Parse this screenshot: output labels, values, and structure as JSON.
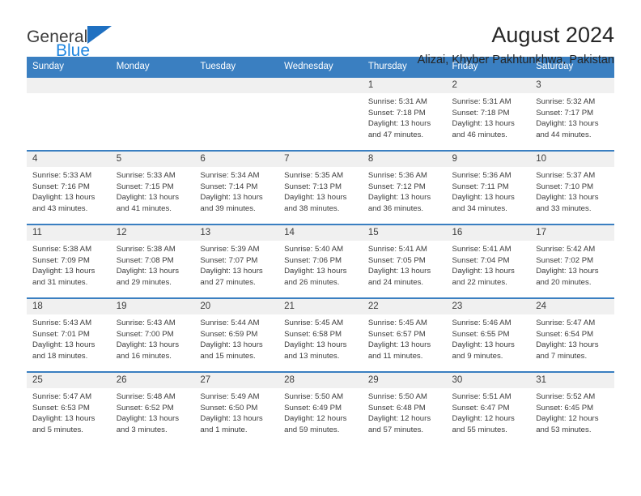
{
  "brand": {
    "line1": "General",
    "line2": "Blue",
    "logo_color": "#1f70c1"
  },
  "header": {
    "title": "August 2024",
    "subtitle": "Alizai, Khyber Pakhtunkhwa, Pakistan"
  },
  "calendar": {
    "header_color": "#3a7fc1",
    "weekdays": [
      "Sunday",
      "Monday",
      "Tuesday",
      "Wednesday",
      "Thursday",
      "Friday",
      "Saturday"
    ],
    "weeks": [
      [
        {
          "day": "",
          "sunrise": "",
          "sunset": "",
          "daylight1": "",
          "daylight2": ""
        },
        {
          "day": "",
          "sunrise": "",
          "sunset": "",
          "daylight1": "",
          "daylight2": ""
        },
        {
          "day": "",
          "sunrise": "",
          "sunset": "",
          "daylight1": "",
          "daylight2": ""
        },
        {
          "day": "",
          "sunrise": "",
          "sunset": "",
          "daylight1": "",
          "daylight2": ""
        },
        {
          "day": "1",
          "sunrise": "Sunrise: 5:31 AM",
          "sunset": "Sunset: 7:18 PM",
          "daylight1": "Daylight: 13 hours",
          "daylight2": "and 47 minutes."
        },
        {
          "day": "2",
          "sunrise": "Sunrise: 5:31 AM",
          "sunset": "Sunset: 7:18 PM",
          "daylight1": "Daylight: 13 hours",
          "daylight2": "and 46 minutes."
        },
        {
          "day": "3",
          "sunrise": "Sunrise: 5:32 AM",
          "sunset": "Sunset: 7:17 PM",
          "daylight1": "Daylight: 13 hours",
          "daylight2": "and 44 minutes."
        }
      ],
      [
        {
          "day": "4",
          "sunrise": "Sunrise: 5:33 AM",
          "sunset": "Sunset: 7:16 PM",
          "daylight1": "Daylight: 13 hours",
          "daylight2": "and 43 minutes."
        },
        {
          "day": "5",
          "sunrise": "Sunrise: 5:33 AM",
          "sunset": "Sunset: 7:15 PM",
          "daylight1": "Daylight: 13 hours",
          "daylight2": "and 41 minutes."
        },
        {
          "day": "6",
          "sunrise": "Sunrise: 5:34 AM",
          "sunset": "Sunset: 7:14 PM",
          "daylight1": "Daylight: 13 hours",
          "daylight2": "and 39 minutes."
        },
        {
          "day": "7",
          "sunrise": "Sunrise: 5:35 AM",
          "sunset": "Sunset: 7:13 PM",
          "daylight1": "Daylight: 13 hours",
          "daylight2": "and 38 minutes."
        },
        {
          "day": "8",
          "sunrise": "Sunrise: 5:36 AM",
          "sunset": "Sunset: 7:12 PM",
          "daylight1": "Daylight: 13 hours",
          "daylight2": "and 36 minutes."
        },
        {
          "day": "9",
          "sunrise": "Sunrise: 5:36 AM",
          "sunset": "Sunset: 7:11 PM",
          "daylight1": "Daylight: 13 hours",
          "daylight2": "and 34 minutes."
        },
        {
          "day": "10",
          "sunrise": "Sunrise: 5:37 AM",
          "sunset": "Sunset: 7:10 PM",
          "daylight1": "Daylight: 13 hours",
          "daylight2": "and 33 minutes."
        }
      ],
      [
        {
          "day": "11",
          "sunrise": "Sunrise: 5:38 AM",
          "sunset": "Sunset: 7:09 PM",
          "daylight1": "Daylight: 13 hours",
          "daylight2": "and 31 minutes."
        },
        {
          "day": "12",
          "sunrise": "Sunrise: 5:38 AM",
          "sunset": "Sunset: 7:08 PM",
          "daylight1": "Daylight: 13 hours",
          "daylight2": "and 29 minutes."
        },
        {
          "day": "13",
          "sunrise": "Sunrise: 5:39 AM",
          "sunset": "Sunset: 7:07 PM",
          "daylight1": "Daylight: 13 hours",
          "daylight2": "and 27 minutes."
        },
        {
          "day": "14",
          "sunrise": "Sunrise: 5:40 AM",
          "sunset": "Sunset: 7:06 PM",
          "daylight1": "Daylight: 13 hours",
          "daylight2": "and 26 minutes."
        },
        {
          "day": "15",
          "sunrise": "Sunrise: 5:41 AM",
          "sunset": "Sunset: 7:05 PM",
          "daylight1": "Daylight: 13 hours",
          "daylight2": "and 24 minutes."
        },
        {
          "day": "16",
          "sunrise": "Sunrise: 5:41 AM",
          "sunset": "Sunset: 7:04 PM",
          "daylight1": "Daylight: 13 hours",
          "daylight2": "and 22 minutes."
        },
        {
          "day": "17",
          "sunrise": "Sunrise: 5:42 AM",
          "sunset": "Sunset: 7:02 PM",
          "daylight1": "Daylight: 13 hours",
          "daylight2": "and 20 minutes."
        }
      ],
      [
        {
          "day": "18",
          "sunrise": "Sunrise: 5:43 AM",
          "sunset": "Sunset: 7:01 PM",
          "daylight1": "Daylight: 13 hours",
          "daylight2": "and 18 minutes."
        },
        {
          "day": "19",
          "sunrise": "Sunrise: 5:43 AM",
          "sunset": "Sunset: 7:00 PM",
          "daylight1": "Daylight: 13 hours",
          "daylight2": "and 16 minutes."
        },
        {
          "day": "20",
          "sunrise": "Sunrise: 5:44 AM",
          "sunset": "Sunset: 6:59 PM",
          "daylight1": "Daylight: 13 hours",
          "daylight2": "and 15 minutes."
        },
        {
          "day": "21",
          "sunrise": "Sunrise: 5:45 AM",
          "sunset": "Sunset: 6:58 PM",
          "daylight1": "Daylight: 13 hours",
          "daylight2": "and 13 minutes."
        },
        {
          "day": "22",
          "sunrise": "Sunrise: 5:45 AM",
          "sunset": "Sunset: 6:57 PM",
          "daylight1": "Daylight: 13 hours",
          "daylight2": "and 11 minutes."
        },
        {
          "day": "23",
          "sunrise": "Sunrise: 5:46 AM",
          "sunset": "Sunset: 6:55 PM",
          "daylight1": "Daylight: 13 hours",
          "daylight2": "and 9 minutes."
        },
        {
          "day": "24",
          "sunrise": "Sunrise: 5:47 AM",
          "sunset": "Sunset: 6:54 PM",
          "daylight1": "Daylight: 13 hours",
          "daylight2": "and 7 minutes."
        }
      ],
      [
        {
          "day": "25",
          "sunrise": "Sunrise: 5:47 AM",
          "sunset": "Sunset: 6:53 PM",
          "daylight1": "Daylight: 13 hours",
          "daylight2": "and 5 minutes."
        },
        {
          "day": "26",
          "sunrise": "Sunrise: 5:48 AM",
          "sunset": "Sunset: 6:52 PM",
          "daylight1": "Daylight: 13 hours",
          "daylight2": "and 3 minutes."
        },
        {
          "day": "27",
          "sunrise": "Sunrise: 5:49 AM",
          "sunset": "Sunset: 6:50 PM",
          "daylight1": "Daylight: 13 hours",
          "daylight2": "and 1 minute."
        },
        {
          "day": "28",
          "sunrise": "Sunrise: 5:50 AM",
          "sunset": "Sunset: 6:49 PM",
          "daylight1": "Daylight: 12 hours",
          "daylight2": "and 59 minutes."
        },
        {
          "day": "29",
          "sunrise": "Sunrise: 5:50 AM",
          "sunset": "Sunset: 6:48 PM",
          "daylight1": "Daylight: 12 hours",
          "daylight2": "and 57 minutes."
        },
        {
          "day": "30",
          "sunrise": "Sunrise: 5:51 AM",
          "sunset": "Sunset: 6:47 PM",
          "daylight1": "Daylight: 12 hours",
          "daylight2": "and 55 minutes."
        },
        {
          "day": "31",
          "sunrise": "Sunrise: 5:52 AM",
          "sunset": "Sunset: 6:45 PM",
          "daylight1": "Daylight: 12 hours",
          "daylight2": "and 53 minutes."
        }
      ]
    ]
  }
}
